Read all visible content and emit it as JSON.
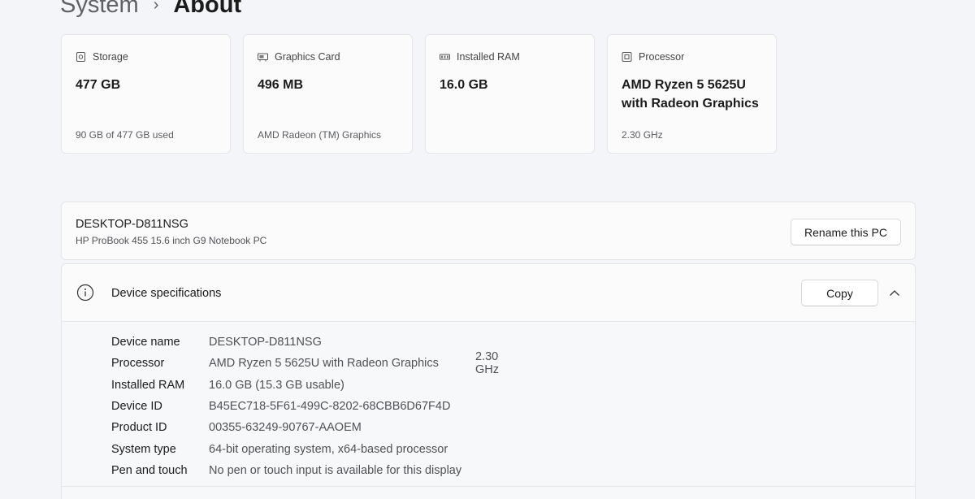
{
  "breadcrumb": {
    "parent": "System",
    "separator": "›",
    "current": "About"
  },
  "cards": [
    {
      "icon": "storage-icon",
      "title": "Storage",
      "value": "477 GB",
      "detail": "90 GB of 477 GB used"
    },
    {
      "icon": "graphics-card-icon",
      "title": "Graphics Card",
      "value": "496 MB",
      "detail": "AMD Radeon (TM) Graphics"
    },
    {
      "icon": "ram-icon",
      "title": "Installed RAM",
      "value": "16.0 GB",
      "detail": ""
    },
    {
      "icon": "processor-icon",
      "title": "Processor",
      "value": "AMD Ryzen 5 5625U with Radeon Graphics",
      "detail": "2.30 GHz"
    }
  ],
  "pc": {
    "name": "DESKTOP-D811NSG",
    "model": "HP ProBook 455 15.6 inch G9 Notebook PC",
    "rename_label": "Rename this PC"
  },
  "specs": {
    "icon": "info-icon",
    "title": "Device specifications",
    "copy_label": "Copy",
    "rows": [
      {
        "label": "Device name",
        "value": "DESKTOP-D811NSG",
        "extra": ""
      },
      {
        "label": "Processor",
        "value": "AMD Ryzen 5 5625U with Radeon Graphics",
        "extra": "2.30 GHz"
      },
      {
        "label": "Installed RAM",
        "value": "16.0 GB (15.3 GB usable)",
        "extra": ""
      },
      {
        "label": "Device ID",
        "value": "B45EC718-5F61-499C-8202-68CBB6D67F4D",
        "extra": ""
      },
      {
        "label": "Product ID",
        "value": "00355-63249-90767-AAOEM",
        "extra": ""
      },
      {
        "label": "System type",
        "value": "64-bit operating system, x64-based processor",
        "extra": ""
      },
      {
        "label": "Pen and touch",
        "value": "No pen or touch input is available for this display",
        "extra": ""
      }
    ]
  }
}
